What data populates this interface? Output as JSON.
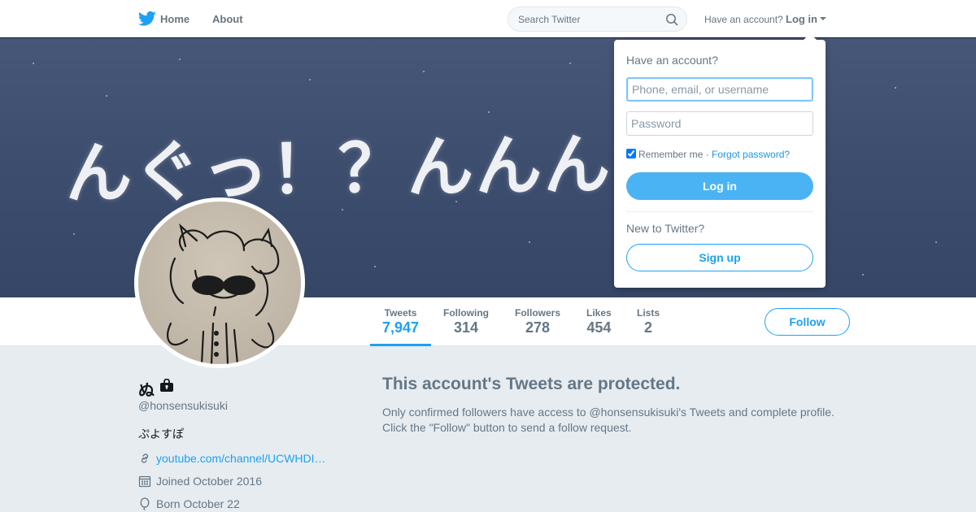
{
  "colors": {
    "accent": "#1da1f2",
    "banner": "#3d4d6e",
    "background": "#e6ecf0"
  },
  "topnav": {
    "logo_icon": "twitter-bird-icon",
    "home_label": "Home",
    "about_label": "About",
    "search_placeholder": "Search Twitter",
    "have_account": "Have an account?",
    "login_label": "Log in"
  },
  "banner": {
    "text": "んぐっ！？んんんんっ！"
  },
  "profile": {
    "name": "ぬ",
    "handle": "@honsensukisuki",
    "bio": "ぷよすぽ",
    "link": "youtube.com/channel/UCWHDI…",
    "joined": "Joined October 2016",
    "born": "Born October 22"
  },
  "stats": [
    {
      "label": "Tweets",
      "value": "7,947"
    },
    {
      "label": "Following",
      "value": "314"
    },
    {
      "label": "Followers",
      "value": "278"
    },
    {
      "label": "Likes",
      "value": "454"
    },
    {
      "label": "Lists",
      "value": "2"
    }
  ],
  "follow_label": "Follow",
  "protected": {
    "title": "This account's Tweets are protected.",
    "description": "Only confirmed followers have access to @honsensukisuki's Tweets and complete profile. Click the \"Follow\" button to send a follow request."
  },
  "login_dropdown": {
    "heading": "Have an account?",
    "username_placeholder": "Phone, email, or username",
    "password_placeholder": "Password",
    "remember_me": "Remember me",
    "separator": " · ",
    "forgot_password": "Forgot password?",
    "login_button": "Log in",
    "new_to_twitter": "New to Twitter?",
    "signup_button": "Sign up"
  }
}
